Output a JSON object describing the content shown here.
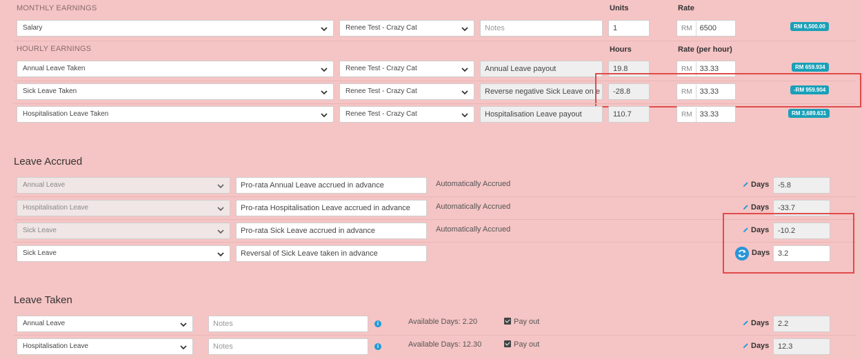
{
  "monthly": {
    "section": "MONTHLY EARNINGS",
    "units_head": "Units",
    "rate_head": "Rate",
    "rows": [
      {
        "type": "Salary",
        "employee": "Renee Test - Crazy Cat",
        "notes": "",
        "notes_placeholder": "Notes",
        "units": "1",
        "rate_prefix": "RM",
        "rate": "6500",
        "total": "RM 6,500.00"
      }
    ]
  },
  "hourly": {
    "section": "HOURLY EARNINGS",
    "hours_head": "Hours",
    "rate_head": "Rate (per hour)",
    "rows": [
      {
        "type": "Annual Leave Taken",
        "employee": "Renee Test - Crazy Cat",
        "notes": "Annual Leave payout",
        "hours": "19.8",
        "rate_prefix": "RM",
        "rate": "33.33",
        "total": "RM 659.934"
      },
      {
        "type": "Sick Leave Taken",
        "employee": "Renee Test - Crazy Cat",
        "notes": "Reverse negative Sick Leave on e",
        "hours": "-28.8",
        "rate_prefix": "RM",
        "rate": "33.33",
        "total": "-RM 959.904"
      },
      {
        "type": "Hospitalisation Leave Taken",
        "employee": "Renee Test - Crazy Cat",
        "notes": "Hospitalisation Leave payout",
        "hours": "110.7",
        "rate_prefix": "RM",
        "rate": "33.33",
        "total": "RM 3,689.631"
      }
    ]
  },
  "accrued": {
    "heading": "Leave Accrued",
    "rows": [
      {
        "type": "Annual Leave",
        "desc": "Pro-rata Annual Leave accrued in advance",
        "mode": "Automatically Accrued",
        "days_label": "Days",
        "days": "-5.8"
      },
      {
        "type": "Hospitalisation Leave",
        "desc": "Pro-rata Hospitalisation Leave accrued in advance",
        "mode": "Automatically Accrued",
        "days_label": "Days",
        "days": "-33.7"
      },
      {
        "type": "Sick Leave",
        "desc": "Pro-rata Sick Leave accrued in advance",
        "mode": "Automatically Accrued",
        "days_label": "Days",
        "days": "-10.2"
      },
      {
        "type": "Sick Leave",
        "desc": "Reversal of Sick Leave taken in advance",
        "mode": "",
        "days_label": "Days",
        "days": "3.2"
      }
    ]
  },
  "taken": {
    "heading": "Leave Taken",
    "rows": [
      {
        "type": "Annual Leave",
        "notes_placeholder": "Notes",
        "available": "Available Days: 2.20",
        "payout": "Pay out",
        "days_label": "Days",
        "days": "2.2"
      },
      {
        "type": "Hospitalisation Leave",
        "notes_placeholder": "Notes",
        "available": "Available Days: 12.30",
        "payout": "Pay out",
        "days_label": "Days",
        "days": "12.3"
      }
    ]
  },
  "icons": {
    "select": "chevron-down-icon",
    "edit": "pencil-icon",
    "refresh": "refresh-icon",
    "info": "info-icon",
    "check": "checkbox-checked-icon"
  },
  "colors": {
    "background": "#f5c4c4",
    "badge": "#1aa0b8",
    "highlight": "#e04a4a",
    "accent": "#1e9bd7"
  }
}
